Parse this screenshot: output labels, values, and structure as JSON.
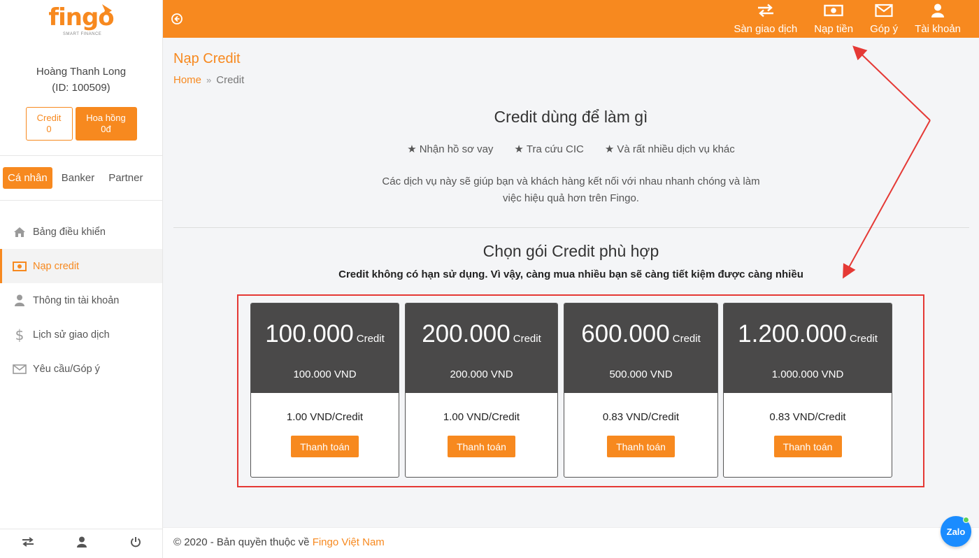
{
  "brand": {
    "logo_text": "fingo",
    "logo_tagline": "SMART FINANCE",
    "accent": "#f7891f",
    "dark": "#4a4949"
  },
  "sidebar": {
    "user_name": "Hoàng Thanh Long",
    "user_id": "(ID: 100509)",
    "credit_label": "Credit",
    "credit_value": "0",
    "commission_label": "Hoa hồng",
    "commission_value": "0đ",
    "roles": [
      "Cá nhân",
      "Banker",
      "Partner"
    ],
    "menu": [
      {
        "label": "Bảng điều khiển",
        "icon": "home-icon"
      },
      {
        "label": "Nạp credit",
        "icon": "money-icon"
      },
      {
        "label": "Thông tin tài khoản",
        "icon": "user-icon"
      },
      {
        "label": "Lịch sử giao dịch",
        "icon": "dollar-icon"
      },
      {
        "label": "Yêu cầu/Góp ý",
        "icon": "envelope-icon"
      }
    ]
  },
  "topbar": {
    "items": [
      {
        "label": "Sàn giao dịch",
        "icon": "exchange-icon"
      },
      {
        "label": "Nạp tiền",
        "icon": "money-icon"
      },
      {
        "label": "Góp ý",
        "icon": "envelope-icon"
      },
      {
        "label": "Tài khoản",
        "icon": "user-icon"
      }
    ]
  },
  "page": {
    "title": "Nạp Credit",
    "breadcrumb_home": "Home",
    "breadcrumb_current": "Credit",
    "heading_use": "Credit dùng để làm gì",
    "features": [
      "Nhận hồ sơ vay",
      "Tra cứu CIC",
      "Và rất nhiều dịch vụ khác"
    ],
    "description": "Các dịch vụ này sẽ giúp bạn và khách hàng kết nối với nhau nhanh chóng và làm việc hiệu quả hơn trên Fingo.",
    "heading_choose": "Chọn gói Credit phù hợp",
    "subheading_choose": "Credit không có hạn sử dụng. Vì vậy, càng mua nhiều bạn sẽ càng tiết kiệm được càng nhiều"
  },
  "packages": [
    {
      "amount": "100.000",
      "unit": "Credit",
      "price": "100.000 VND",
      "rate": "1.00 VND/Credit",
      "button": "Thanh toán"
    },
    {
      "amount": "200.000",
      "unit": "Credit",
      "price": "200.000 VND",
      "rate": "1.00 VND/Credit",
      "button": "Thanh toán"
    },
    {
      "amount": "600.000",
      "unit": "Credit",
      "price": "500.000 VND",
      "rate": "0.83 VND/Credit",
      "button": "Thanh toán"
    },
    {
      "amount": "1.200.000",
      "unit": "Credit",
      "price": "1.000.000 VND",
      "rate": "0.83 VND/Credit",
      "button": "Thanh toán"
    }
  ],
  "footer": {
    "text": "© 2020 - Bản quyền thuộc về ",
    "brand": "Fingo Việt Nam"
  },
  "zalo_label": "Zalo"
}
